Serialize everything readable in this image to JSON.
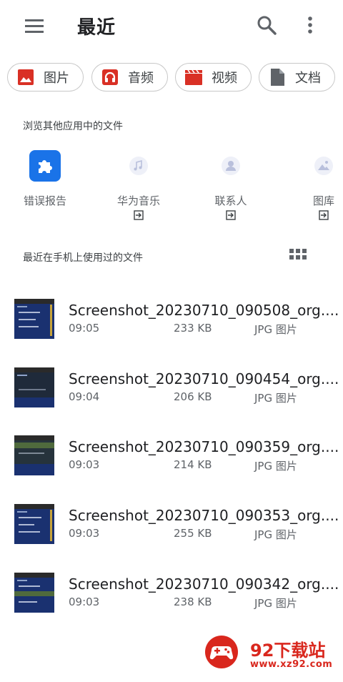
{
  "header": {
    "title": "最近",
    "menu_icon": "hamburger-menu-icon",
    "search_icon": "search-icon",
    "more_icon": "more-vert-icon"
  },
  "categories": [
    {
      "label": "图片",
      "icon": "image-icon",
      "color": "#d93025"
    },
    {
      "label": "音频",
      "icon": "headphones-icon",
      "color": "#d93025"
    },
    {
      "label": "视频",
      "icon": "movie-clapper-icon",
      "color": "#d93025"
    },
    {
      "label": "文档",
      "icon": "document-icon",
      "color": "#5f6368"
    }
  ],
  "other_apps": {
    "title": "浏览其他应用中的文件",
    "items": [
      {
        "label": "错误报告",
        "icon": "puzzle-piece-icon"
      },
      {
        "label": "华为音乐",
        "icon": "music-app-icon"
      },
      {
        "label": "联系人",
        "icon": "contacts-app-icon"
      },
      {
        "label": "图库",
        "icon": "gallery-app-icon"
      }
    ]
  },
  "recent": {
    "title": "最近在手机上使用过的文件",
    "view_toggle_icon": "grid-view-icon",
    "files": [
      {
        "name": "Screenshot_20230710_090508_org....",
        "time": "09:05",
        "size": "233 KB",
        "type": "JPG 图片"
      },
      {
        "name": "Screenshot_20230710_090454_org....",
        "time": "09:04",
        "size": "206 KB",
        "type": "JPG 图片"
      },
      {
        "name": "Screenshot_20230710_090359_org....",
        "time": "09:03",
        "size": "214 KB",
        "type": "JPG 图片"
      },
      {
        "name": "Screenshot_20230710_090353_org....",
        "time": "09:03",
        "size": "255 KB",
        "type": "JPG 图片"
      },
      {
        "name": "Screenshot_20230710_090342_org....",
        "time": "09:03",
        "size": "238 KB",
        "type": "JPG 图片"
      }
    ]
  },
  "watermark": {
    "name": "92下载站",
    "url": "www.xz92.com"
  },
  "colors": {
    "accent_red": "#d93025",
    "puzzle_blue": "#1a73e8",
    "watermark_red": "#d9271d"
  }
}
